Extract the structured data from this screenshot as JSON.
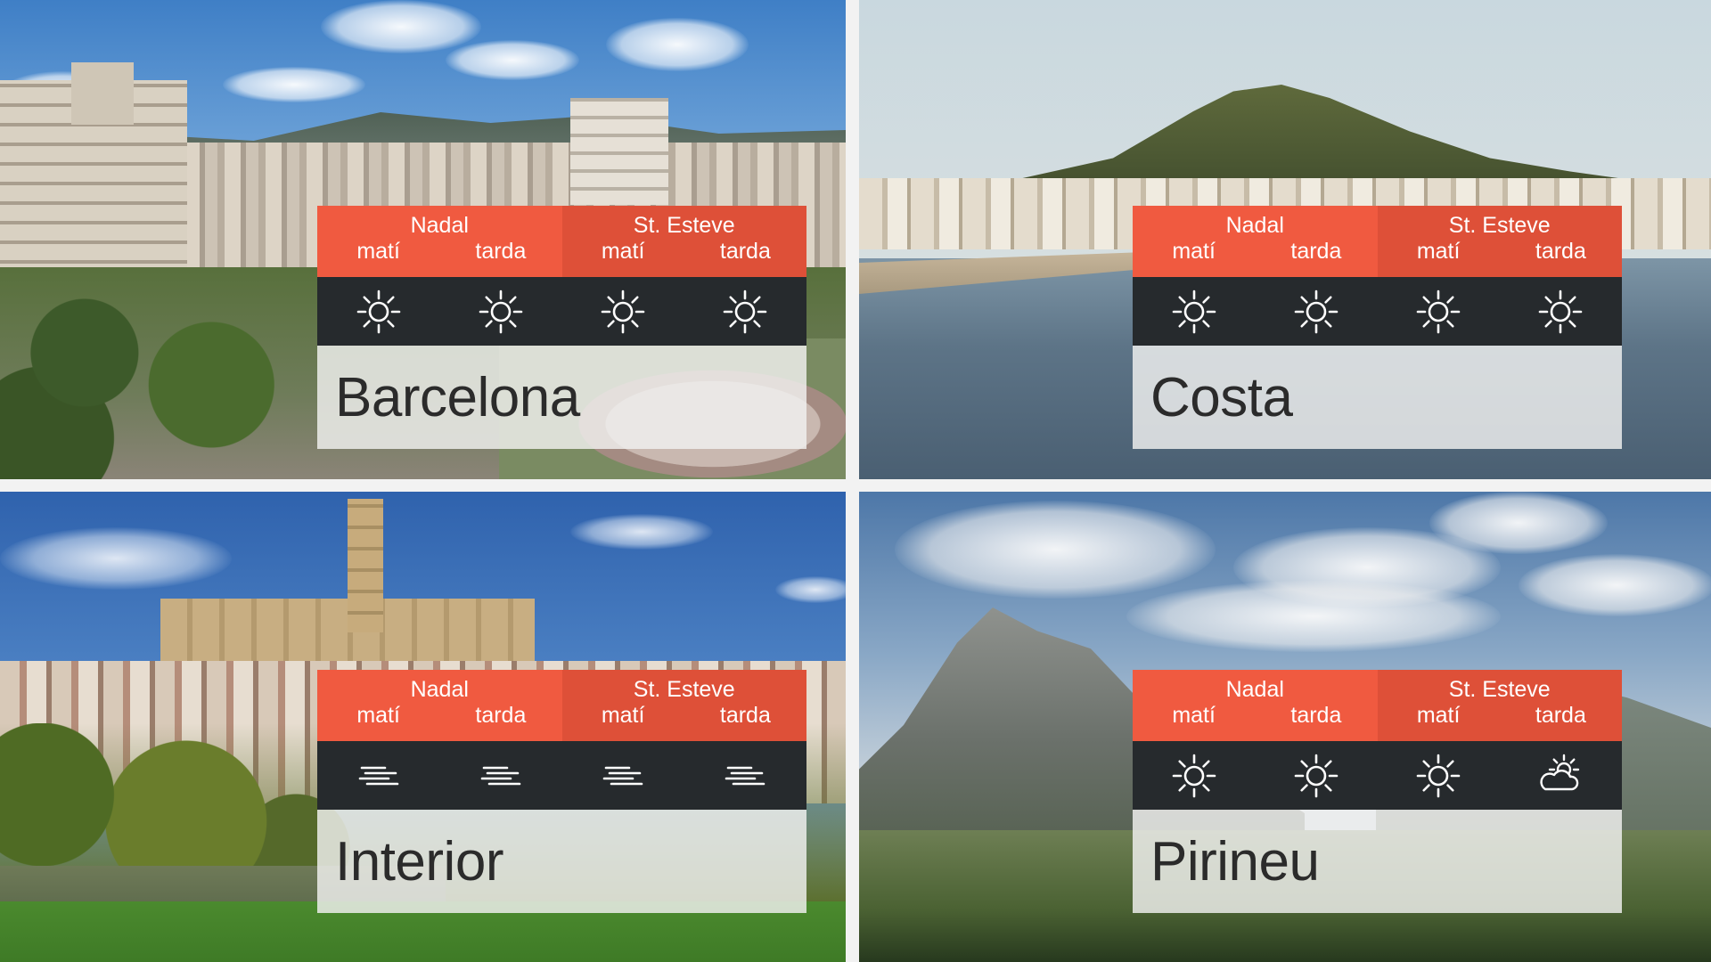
{
  "days": {
    "first": {
      "label": "Nadal",
      "slots": [
        "matí",
        "tarda"
      ]
    },
    "second": {
      "label": "St. Esteve",
      "slots": [
        "matí",
        "tarda"
      ]
    }
  },
  "regions": [
    {
      "name": "Barcelona",
      "icons": [
        "sun-icon",
        "sun-icon",
        "sun-icon",
        "sun-icon"
      ]
    },
    {
      "name": "Costa",
      "icons": [
        "sun-icon",
        "sun-icon",
        "sun-icon",
        "sun-icon"
      ]
    },
    {
      "name": "Interior",
      "icons": [
        "fog-icon",
        "fog-icon",
        "fog-icon",
        "fog-icon"
      ]
    },
    {
      "name": "Pirineu",
      "icons": [
        "sun-icon",
        "sun-icon",
        "sun-icon",
        "sun-cloud-icon"
      ]
    }
  ],
  "colors": {
    "header_primary": "#f05a40",
    "header_secondary": "#de5038",
    "icon_bar": "#262a2d",
    "name_panel": "#f2f2f0"
  }
}
